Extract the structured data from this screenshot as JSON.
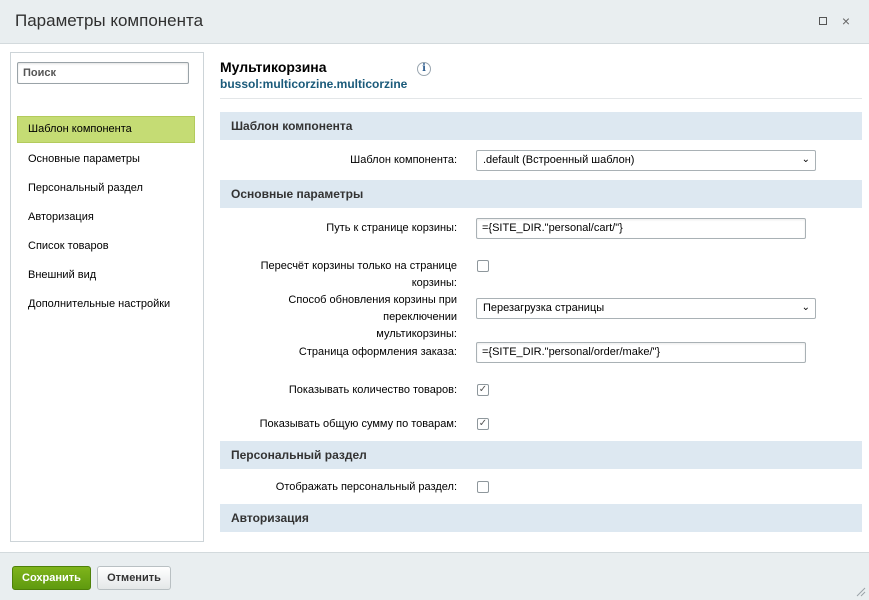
{
  "window": {
    "title": "Параметры компонента",
    "maximize_icon": "maximize-icon",
    "close_icon": "close-icon",
    "close_glyph": "×"
  },
  "sidebar": {
    "search_placeholder": "Поиск",
    "items": [
      {
        "label": "Шаблон компонента",
        "active": true
      },
      {
        "label": "Основные параметры",
        "active": false
      },
      {
        "label": "Персональный раздел",
        "active": false
      },
      {
        "label": "Авторизация",
        "active": false
      },
      {
        "label": "Список товаров",
        "active": false
      },
      {
        "label": "Внешний вид",
        "active": false
      },
      {
        "label": "Дополнительные настройки",
        "active": false
      }
    ]
  },
  "component": {
    "title": "Мультикорзина",
    "code": "bussol:multicorzine.multicorzine",
    "info_glyph": "i"
  },
  "sections": {
    "template": {
      "title": "Шаблон компонента",
      "template_label": "Шаблон компонента:",
      "template_value": ".default (Встроенный шаблон)"
    },
    "main": {
      "title": "Основные параметры",
      "cart_path_label": "Путь к странице корзины:",
      "cart_path_value": "={SITE_DIR.\"personal/cart/\"}",
      "recalc_label": "Пересчёт корзины только на странице корзины:",
      "recalc_checked": false,
      "update_method_label_1": "Способ обновления корзины при переключении",
      "update_method_label_2": "мультикорзины:",
      "update_method_value": "Перезагрузка страницы",
      "order_page_label": "Страница оформления заказа:",
      "order_page_value": "={SITE_DIR.\"personal/order/make/\"}",
      "show_count_label": "Показывать количество товаров:",
      "show_count_checked": true,
      "show_sum_label": "Показывать общую сумму по товарам:",
      "show_sum_checked": true
    },
    "personal": {
      "title": "Персональный раздел",
      "show_personal_label": "Отображать персональный раздел:",
      "show_personal_checked": false
    },
    "auth": {
      "title": "Авторизация"
    }
  },
  "check_glyph": "✓",
  "chevron_glyph": "⌄",
  "footer": {
    "save_label": "Сохранить",
    "cancel_label": "Отменить"
  },
  "colors": {
    "accent_green": "#6fa815",
    "active_item": "#c5dc74",
    "section_bg": "#dde8f1",
    "code_link": "#1a5a7a"
  }
}
